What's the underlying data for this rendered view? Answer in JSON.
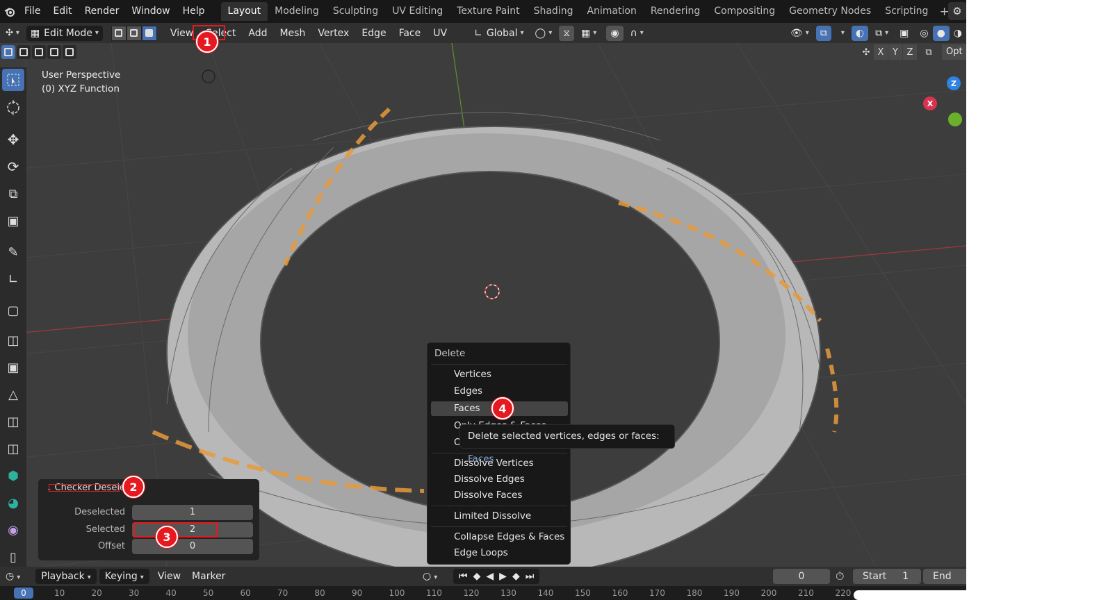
{
  "menubar": {
    "items": [
      "File",
      "Edit",
      "Render",
      "Window",
      "Help"
    ]
  },
  "workspaces": {
    "tabs": [
      "Layout",
      "Modeling",
      "Sculpting",
      "UV Editing",
      "Texture Paint",
      "Shading",
      "Animation",
      "Rendering",
      "Compositing",
      "Geometry Nodes",
      "Scripting"
    ],
    "active": "Layout"
  },
  "header": {
    "mode": "Edit Mode",
    "menus": [
      "View",
      "Select",
      "Add",
      "Mesh",
      "Vertex",
      "Edge",
      "Face",
      "UV"
    ],
    "orientation": "Global"
  },
  "viewport": {
    "perspective": "User Perspective",
    "object": "(0) XYZ Function",
    "axis_x": "X",
    "axis_y": "Y",
    "axis_z": "Z",
    "options": "Opt",
    "gizmo": {
      "x": "X",
      "z": "Z"
    }
  },
  "operator_panel": {
    "title": "Checker Deselect",
    "deselected_label": "Deselected",
    "deselected_value": "1",
    "selected_label": "Selected",
    "selected_value": "2",
    "offset_label": "Offset",
    "offset_value": "0"
  },
  "context_menu": {
    "title": "Delete",
    "items": [
      "Vertices",
      "Edges",
      "Faces",
      "Only Edges & Faces",
      "Only Faces",
      "Dissolve Vertices",
      "Dissolve Edges",
      "Dissolve Faces",
      "Limited Dissolve",
      "Collapse Edges & Faces",
      "Edge Loops"
    ],
    "highlighted": "Faces"
  },
  "tooltip": {
    "text": "Delete selected vertices, edges or faces:",
    "value": "Faces"
  },
  "timeline": {
    "playback": "Playback",
    "keying": "Keying",
    "view": "View",
    "marker": "Marker",
    "current_frame": "0",
    "start_label": "Start",
    "start_value": "1",
    "end_label": "End"
  },
  "ruler": {
    "ticks": [
      "0",
      "10",
      "20",
      "30",
      "40",
      "50",
      "60",
      "70",
      "80",
      "90",
      "100",
      "110",
      "120",
      "130",
      "140",
      "150",
      "160",
      "170",
      "180",
      "190",
      "200",
      "210",
      "220"
    ]
  },
  "annotations": [
    "1",
    "2",
    "3",
    "4"
  ],
  "colors": {
    "accent": "#4772b3",
    "annotation": "#e5191f",
    "selection": "#f0a040"
  }
}
